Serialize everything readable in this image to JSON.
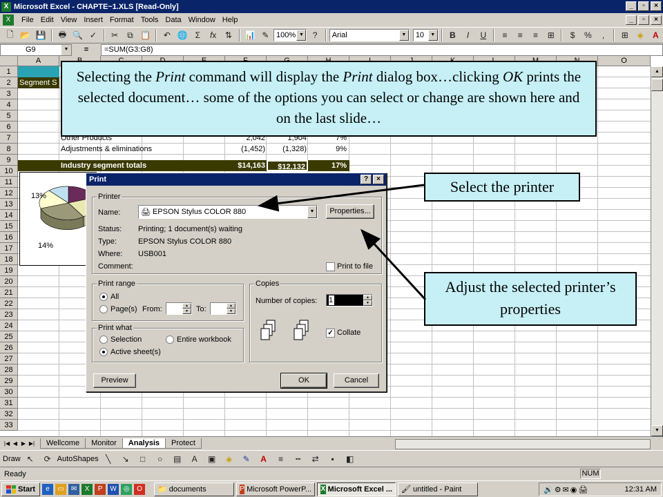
{
  "app": {
    "title": "Microsoft Excel - CHAPTE~1.XLS  [Read-Only]",
    "menu": [
      "File",
      "Edit",
      "View",
      "Insert",
      "Format",
      "Tools",
      "Data",
      "Window",
      "Help"
    ],
    "zoom": "100%",
    "font": "Arial",
    "font_size": "10",
    "name_box": "G9",
    "formula": "=SUM(G3:G8)"
  },
  "sheet": {
    "columns": [
      "A",
      "B",
      "C",
      "D",
      "E",
      "F",
      "G",
      "H",
      "I",
      "J",
      "K",
      "L",
      "M",
      "N",
      "O"
    ],
    "rows": [
      "1",
      "2",
      "3",
      "4",
      "5",
      "6",
      "7",
      "8",
      "9",
      "10",
      "11",
      "12",
      "13",
      "14",
      "15",
      "16",
      "17",
      "18",
      "19",
      "20",
      "21",
      "22",
      "23",
      "24",
      "25",
      "26",
      "27",
      "28",
      "29",
      "30",
      "31",
      "32",
      "33"
    ],
    "a2": "Segment S",
    "row7": {
      "label": "Other Products",
      "f": "2,042",
      "g": "1,904",
      "h": "7%"
    },
    "row8": {
      "label": "Adjustments & eliminations",
      "f": "(1,452)",
      "g": "(1,328)",
      "h": "9%"
    },
    "row9": {
      "label": "Industry segment totals",
      "f": "$14,163",
      "g": "$12,132",
      "h": "17%"
    },
    "chart_labels": {
      "l13": "13%",
      "l14": "14%"
    },
    "tabs": [
      "Wellcome",
      "Monitor",
      "Analysis",
      "Protect"
    ]
  },
  "draw": {
    "draw_label": "Draw",
    "autoshapes_label": "AutoShapes"
  },
  "status": {
    "ready": "Ready",
    "num": "NUM"
  },
  "taskbar": {
    "start": "Start",
    "tasks": [
      "documents",
      "Microsoft PowerP...",
      "Microsoft Excel ...",
      "untitled - Paint"
    ],
    "clock": "12:31 AM"
  },
  "dialog": {
    "title": "Print",
    "printer_group": "Printer",
    "name_label": "Name:",
    "printer_name": "EPSON Stylus COLOR 880",
    "properties_button": "Properties...",
    "status_label": "Status:",
    "status_value": "Printing; 1 document(s) waiting",
    "type_label": "Type:",
    "type_value": "EPSON Stylus COLOR 880",
    "where_label": "Where:",
    "where_value": "USB001",
    "comment_label": "Comment:",
    "print_to_file": "Print to file",
    "range_group": "Print range",
    "range_all": "All",
    "range_pages": "Page(s)",
    "from_label": "From:",
    "to_label": "To:",
    "what_group": "Print what",
    "what_selection": "Selection",
    "what_workbook": "Entire workbook",
    "what_active": "Active sheet(s)",
    "copies_group": "Copies",
    "copies_label": "Number of copies:",
    "copies_value": "1",
    "collate_label": "Collate",
    "preview_button": "Preview",
    "ok_button": "OK",
    "cancel_button": "Cancel"
  },
  "callouts": {
    "main": "Selecting the Print command will display the Print dialog box…clicking OK prints the selected document… some of the options you can select or change are shown here and on the last slide…",
    "main_html_parts": [
      "Selecting the ",
      "Print",
      " command will display the ",
      "Print",
      " dialog box…clicking ",
      "OK",
      " prints the selected document… some of the options you can select or change are shown here and on the last slide…"
    ],
    "printer": "Select the printer",
    "properties": "Adjust the selected printer’s properties"
  }
}
